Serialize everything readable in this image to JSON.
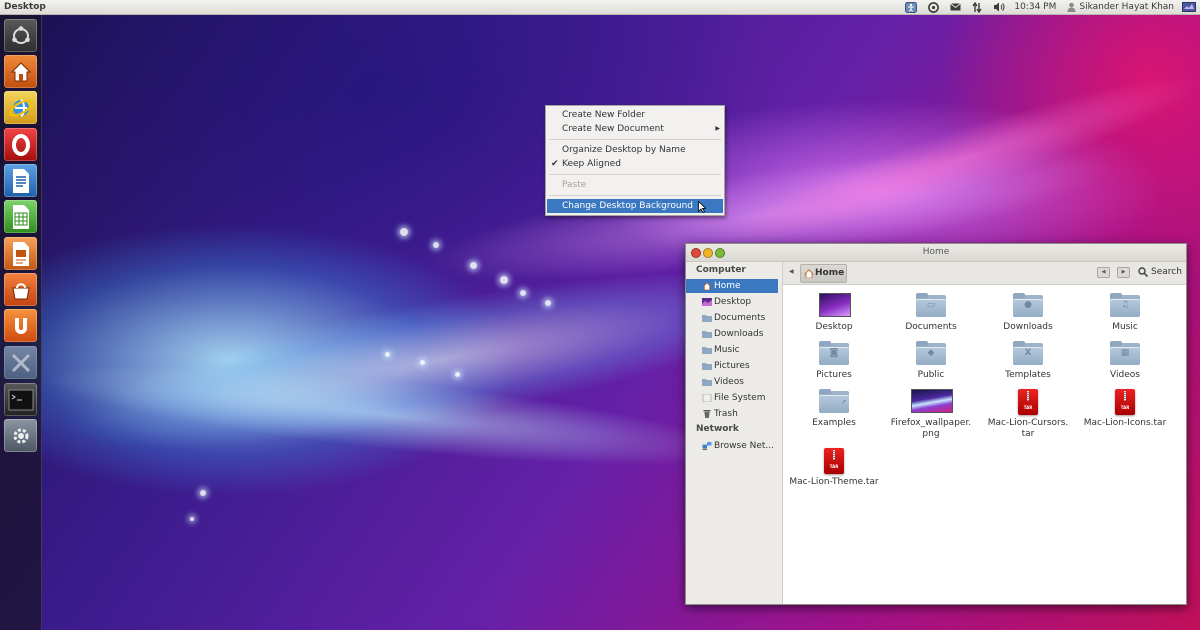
{
  "top_panel": {
    "title": "Desktop",
    "time": "10:34 PM",
    "user": "Sikander Hayat Khan"
  },
  "launcher": {
    "items": [
      {
        "icon": "ubuntu-dash-icon"
      },
      {
        "icon": "home-folder-icon"
      },
      {
        "icon": "internet-explorer-icon"
      },
      {
        "icon": "opera-browser-icon"
      },
      {
        "icon": "libreoffice-writer-icon"
      },
      {
        "icon": "libreoffice-calc-icon"
      },
      {
        "icon": "libreoffice-impress-icon"
      },
      {
        "icon": "software-center-icon"
      },
      {
        "icon": "ubuntu-one-icon"
      },
      {
        "icon": "system-tools-icon"
      },
      {
        "icon": "terminal-icon"
      },
      {
        "icon": "system-settings-icon"
      }
    ]
  },
  "context_menu": {
    "create_folder": "Create New Folder",
    "create_document": "Create New Document",
    "organize": "Organize Desktop by Name",
    "keep_aligned": "Keep Aligned",
    "keep_aligned_checked": true,
    "paste": "Paste",
    "change_background": "Change Desktop Background"
  },
  "file_manager": {
    "title": "Home",
    "sidebar": {
      "computer_heading": "Computer",
      "network_heading": "Network",
      "places": [
        {
          "label": "Home",
          "icon": "home-icon",
          "active": true
        },
        {
          "label": "Desktop",
          "icon": "desktop-icon"
        },
        {
          "label": "Documents",
          "icon": "folder-icon"
        },
        {
          "label": "Downloads",
          "icon": "folder-icon"
        },
        {
          "label": "Music",
          "icon": "folder-icon"
        },
        {
          "label": "Pictures",
          "icon": "folder-icon"
        },
        {
          "label": "Videos",
          "icon": "folder-icon"
        },
        {
          "label": "File System",
          "icon": "drive-icon"
        },
        {
          "label": "Trash",
          "icon": "trash-icon"
        }
      ],
      "network": [
        {
          "label": "Browse Net...",
          "icon": "network-icon"
        }
      ]
    },
    "toolbar": {
      "breadcrumb": "Home",
      "search": "Search"
    },
    "files": [
      {
        "name": "Desktop",
        "icon": "desktop-thumbnail"
      },
      {
        "name": "Documents",
        "icon": "folder-documents"
      },
      {
        "name": "Downloads",
        "icon": "folder-downloads"
      },
      {
        "name": "Music",
        "icon": "folder-music"
      },
      {
        "name": "Pictures",
        "icon": "folder-pictures"
      },
      {
        "name": "Public",
        "icon": "folder-public"
      },
      {
        "name": "Templates",
        "icon": "folder-templates"
      },
      {
        "name": "Videos",
        "icon": "folder-videos"
      },
      {
        "name": "Examples",
        "icon": "folder-examples"
      },
      {
        "name": "Firefox_wallpaper.\npng",
        "icon": "image-thumbnail"
      },
      {
        "name": "Mac-Lion-Cursors.\ntar",
        "icon": "tar-archive"
      },
      {
        "name": "Mac-Lion-Icons.tar",
        "icon": "tar-archive"
      },
      {
        "name": "Mac-Lion-Theme.tar",
        "icon": "tar-archive"
      }
    ]
  },
  "colors": {
    "selection": "#3a78c2",
    "close_button": "#e0463a",
    "minimize_button": "#f0b429",
    "maximize_button": "#7ab83a"
  }
}
